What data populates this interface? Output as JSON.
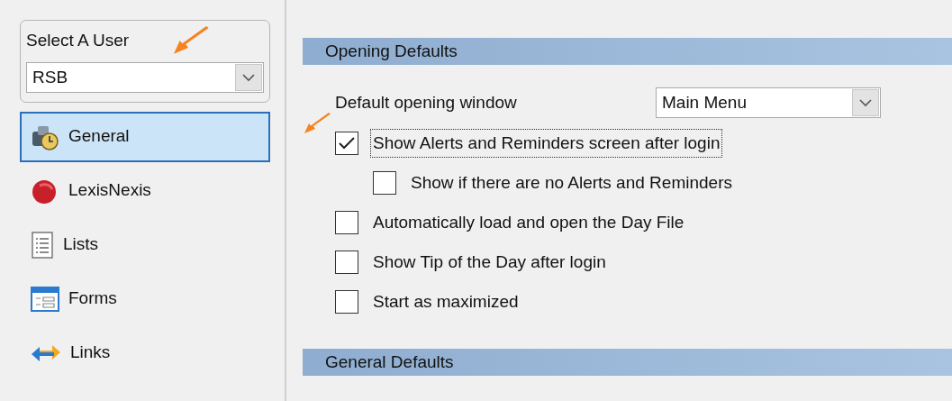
{
  "user_select": {
    "label": "Select A User",
    "value": "RSB"
  },
  "nav_items": [
    {
      "label": "General",
      "selected": true
    },
    {
      "label": "LexisNexis",
      "selected": false
    },
    {
      "label": "Lists",
      "selected": false
    },
    {
      "label": "Forms",
      "selected": false
    },
    {
      "label": "Links",
      "selected": false
    }
  ],
  "sections": [
    {
      "title": "Opening Defaults",
      "fields": [
        {
          "kind": "select",
          "label": "Default opening window",
          "value": "Main Menu"
        },
        {
          "kind": "checkbox",
          "label": "Show  Alerts and Reminders screen after login",
          "checked": true,
          "focused": true,
          "children": [
            {
              "kind": "checkbox",
              "label": "Show if there are no Alerts and Reminders",
              "checked": false
            }
          ]
        },
        {
          "kind": "checkbox",
          "label": "Automatically load and open the Day File",
          "checked": false
        },
        {
          "kind": "checkbox",
          "label": "Show Tip of the Day after login",
          "checked": false
        },
        {
          "kind": "checkbox",
          "label": "Start as maximized",
          "checked": false
        }
      ]
    },
    {
      "title": "General Defaults"
    }
  ]
}
